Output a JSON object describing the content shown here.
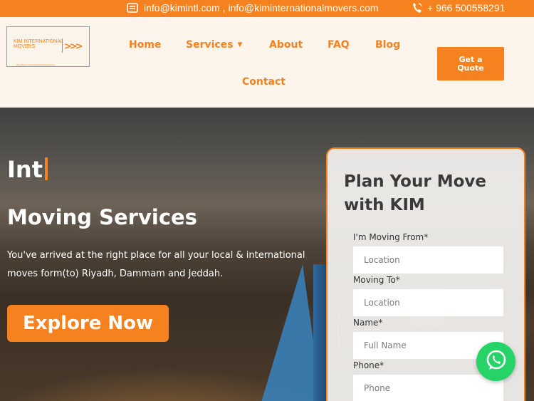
{
  "topbar": {
    "emails": "info@kimintl.com , info@kiminternationalmovers.com",
    "phone": "+ 966 500558291"
  },
  "logo": {
    "text": "KIM INTERNATIONAL MOVERS",
    "tagline": "We deliver everything Everything Always"
  },
  "nav": {
    "home": "Home",
    "services": "Services",
    "about": "About",
    "faq": "FAQ",
    "blog": "Blog",
    "contact": "Contact",
    "quote": "Get a Quote"
  },
  "hero": {
    "typed": "Int",
    "title": "Moving Services",
    "description": "You've arrived at the right place for all your local & international moves form(to) Riyadh, Dammam and Jeddah.",
    "cta": "Explore Now"
  },
  "form": {
    "title": "Plan Your Move with KIM",
    "from_label": "I'm Moving From*",
    "from_placeholder": "Location",
    "to_label": "Moving To*",
    "to_placeholder": "Location",
    "name_label": "Name*",
    "name_placeholder": "Full Name",
    "phone_label": "Phone*",
    "phone_placeholder": "Phone"
  },
  "icons": {
    "email": "email-icon",
    "phone": "phone-icon",
    "caret": "chevron-down-icon",
    "whatsapp": "whatsapp-icon"
  },
  "colors": {
    "accent": "#f5821f",
    "header_bg": "#fdf5ec",
    "whatsapp": "#25d366"
  }
}
